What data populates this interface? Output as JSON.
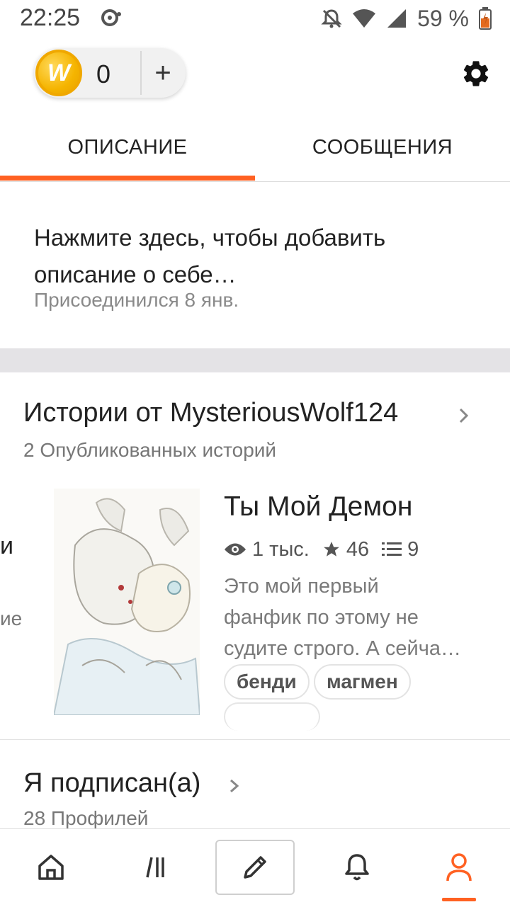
{
  "status_bar": {
    "time": "22:25",
    "battery": "59 %",
    "icons": [
      "data-saver-icon",
      "bell-off-icon",
      "wifi-icon",
      "signal-icon",
      "battery-charging-icon"
    ]
  },
  "topbar": {
    "coin_count": "0",
    "plus_label": "+",
    "coin_logo_letter": "W",
    "settings_icon": "gear-icon"
  },
  "tabs": [
    {
      "label": "ОПИСАНИЕ",
      "active": true
    },
    {
      "label": "СООБЩЕНИЯ",
      "active": false
    }
  ],
  "accent_color": "#ff6122",
  "about": {
    "placeholder_line1": "Нажмите здесь, чтобы добавить",
    "placeholder_line2": "описание о себе…",
    "joined": "Присоединился 8 янв."
  },
  "stories": {
    "title": "Истории от MysteriousWolf124",
    "subtitle": "2 Опубликованных историй",
    "peek_letter": "и",
    "peek_subtext": "ие",
    "items": [
      {
        "title": "Ты Мой Демон",
        "reads": "1 тыс.",
        "votes": "46",
        "parts": "9",
        "description_line1": "Это мой первый",
        "description_line2": "фанфик по этому не",
        "description_line3": "судите строго. А сейча…",
        "tags": [
          "бенди",
          "магмен"
        ]
      }
    ]
  },
  "following": {
    "title": "Я подписан(а)",
    "subtitle": "28 Профилей"
  },
  "bottom_nav": [
    "home-icon",
    "library-icon",
    "write-icon",
    "notifications-icon",
    "profile-icon"
  ]
}
